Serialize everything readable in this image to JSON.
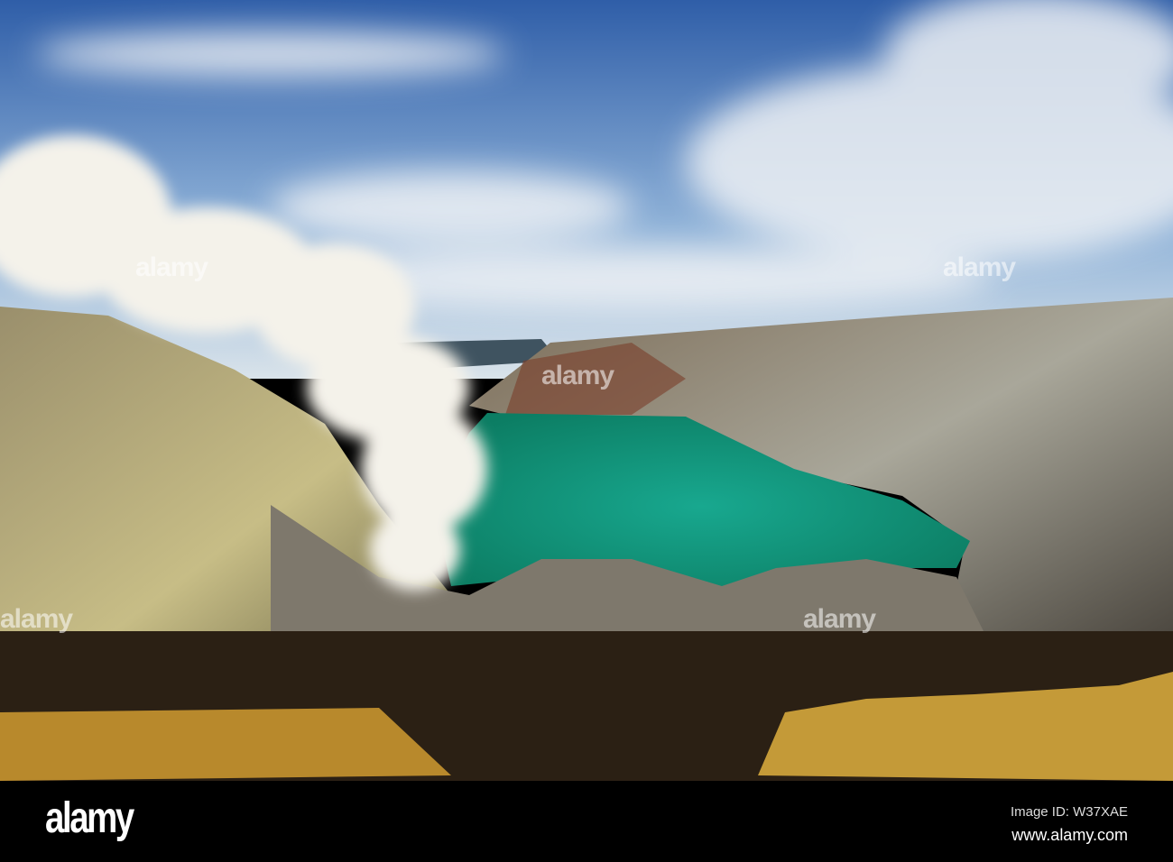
{
  "photo": {
    "subject": "crater-lake",
    "colors": {
      "sky": "#3f6fb0",
      "lake": "#1aa58a",
      "rock": "#8a7d55",
      "sulfur": "#c9a23c"
    }
  },
  "watermark": {
    "text": "alamy"
  },
  "footer": {
    "logo": "alamy",
    "image_id": "Image ID: W37XAE",
    "url": "www.alamy.com"
  }
}
